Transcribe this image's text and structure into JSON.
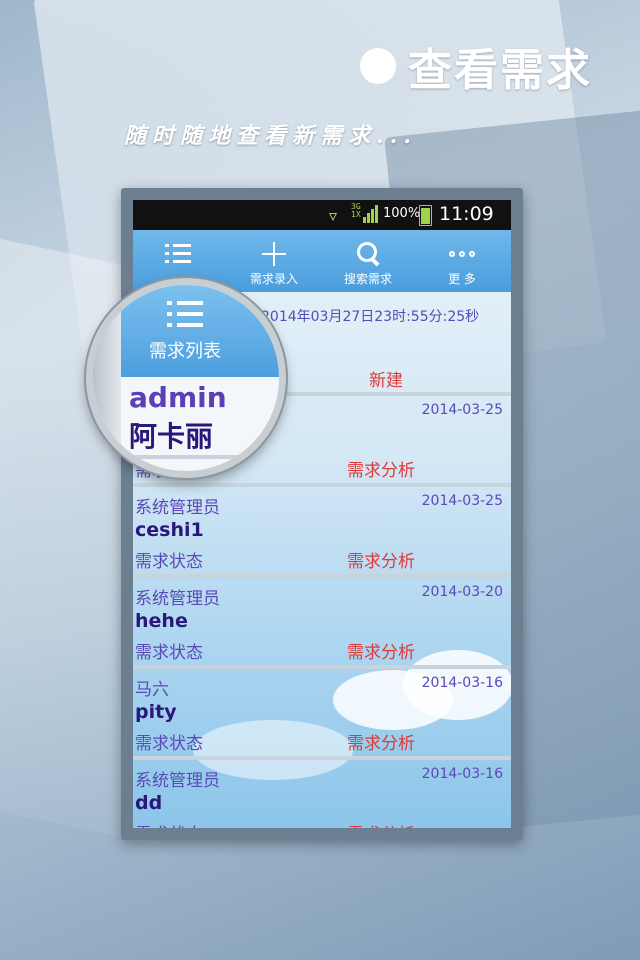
{
  "promo": {
    "title": "查看需求",
    "subtitle": "随时随地查看新需求..."
  },
  "statusbar": {
    "network": [
      "3G",
      "1X"
    ],
    "battery": "100%",
    "time": "11:09"
  },
  "toolbar": {
    "items": [
      {
        "label": "",
        "icon": "list-icon"
      },
      {
        "label": "需求录入",
        "icon": "plus-icon"
      },
      {
        "label": "搜索需求",
        "icon": "search-icon"
      },
      {
        "label": "更 多",
        "icon": "more-icon"
      }
    ]
  },
  "timestamp": "2014年03月27日23时:55分:25秒",
  "first_item_status": "新建",
  "items": [
    {
      "owner": "",
      "date": "2014-03-25",
      "name": "",
      "status_label": "需求状态",
      "status_value": "需求分析"
    },
    {
      "owner": "系统管理员",
      "date": "2014-03-25",
      "name": "ceshi1",
      "status_label": "需求状态",
      "status_value": "需求分析"
    },
    {
      "owner": "系统管理员",
      "date": "2014-03-20",
      "name": "hehe",
      "status_label": "需求状态",
      "status_value": "需求分析"
    },
    {
      "owner": "马六",
      "date": "2014-03-16",
      "name": "pity",
      "status_label": "需求状态",
      "status_value": "需求分析"
    },
    {
      "owner": "系统管理员",
      "date": "2014-03-16",
      "name": "dd",
      "status_label": "需求状态",
      "status_value": "需求分析"
    }
  ],
  "magnifier": {
    "tab_label": "需求列表",
    "name": "admin",
    "owner": "阿卡丽"
  }
}
